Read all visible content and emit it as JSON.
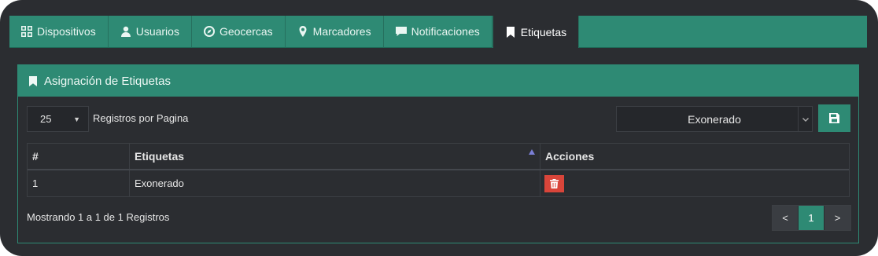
{
  "tabs": [
    {
      "label": "Dispositivos",
      "icon": "grid-icon"
    },
    {
      "label": "Usuarios",
      "icon": "user-icon"
    },
    {
      "label": "Geocercas",
      "icon": "compass-icon"
    },
    {
      "label": "Marcadores",
      "icon": "map-marker-icon"
    },
    {
      "label": "Notificaciones",
      "icon": "comment-icon"
    },
    {
      "label": "Etiquetas",
      "icon": "bookmark-icon",
      "active": true
    }
  ],
  "panel": {
    "title": "Asignación de Etiquetas"
  },
  "toolbar": {
    "page_size": "25",
    "page_size_label": "Registros por Pagina",
    "tag_selected": "Exonerado"
  },
  "table": {
    "headers": [
      "#",
      "Etiquetas",
      "Acciones"
    ],
    "rows": [
      {
        "num": "1",
        "tag": "Exonerado"
      }
    ]
  },
  "footer": {
    "info": "Mostrando 1 a 1 de 1 Registros",
    "prev": "<",
    "current": "1",
    "next": ">"
  },
  "colors": {
    "accent": "#2e8a74",
    "background": "#2b2d31",
    "danger": "#d9453a"
  }
}
